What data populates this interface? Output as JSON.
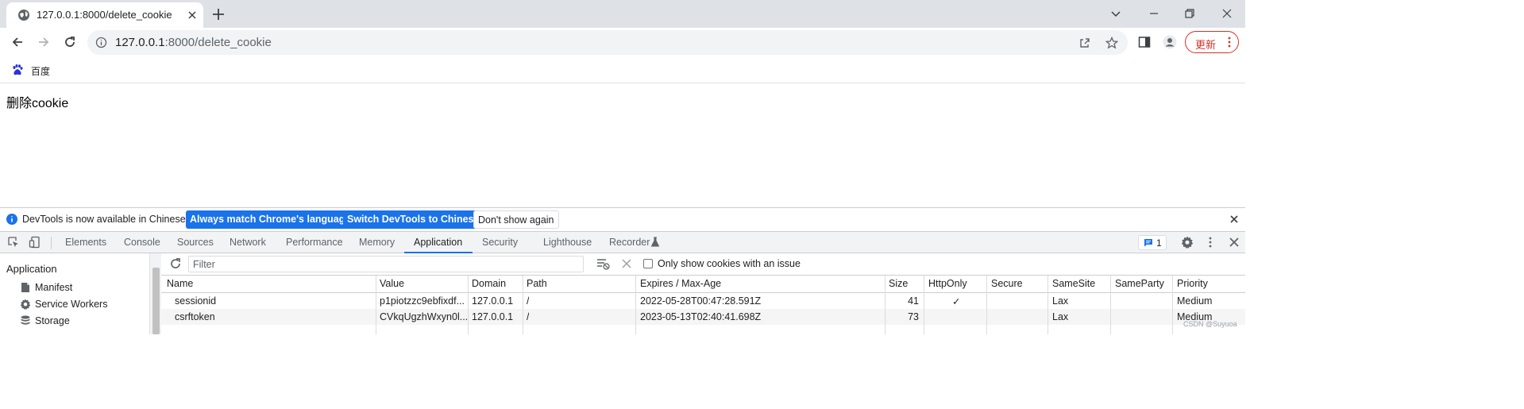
{
  "browser": {
    "tab_title": "127.0.0.1:8000/delete_cookie",
    "url_host": "127.0.0.1",
    "url_rest": ":8000/delete_cookie",
    "update_label": "更新",
    "accent": "#1a73e8",
    "update_color": "#d93025"
  },
  "bookmarks": [
    {
      "label": "百度",
      "icon": "baidu-paw-icon"
    }
  ],
  "page": {
    "text": "删除cookie"
  },
  "devtools": {
    "infobar": {
      "message": "DevTools is now available in Chinese!",
      "btn_match": "Always match Chrome's language",
      "btn_switch": "Switch DevTools to Chinese",
      "btn_dismiss": "Don't show again"
    },
    "tabs": [
      "Elements",
      "Console",
      "Sources",
      "Network",
      "Performance",
      "Memory",
      "Application",
      "Security",
      "Lighthouse",
      "Recorder"
    ],
    "active_tab": "Application",
    "issues_count": "1",
    "sidebar": {
      "heading": "Application",
      "items": [
        {
          "label": "Manifest",
          "icon": "file-icon"
        },
        {
          "label": "Service Workers",
          "icon": "gear-icon"
        },
        {
          "label": "Storage",
          "icon": "database-icon"
        }
      ]
    },
    "cookies": {
      "filter_placeholder": "Filter",
      "only_issue_label": "Only show cookies with an issue",
      "columns": [
        "Name",
        "Value",
        "Domain",
        "Path",
        "Expires / Max-Age",
        "Size",
        "HttpOnly",
        "Secure",
        "SameSite",
        "SameParty",
        "Priority"
      ],
      "rows": [
        {
          "name": "sessionid",
          "value": "p1piotzzc9ebfixdf...",
          "domain": "127.0.0.1",
          "path": "/",
          "expires": "2022-05-28T00:47:28.591Z",
          "size": "41",
          "httponly": "✓",
          "secure": "",
          "samesite": "Lax",
          "sameparty": "",
          "priority": "Medium"
        },
        {
          "name": "csrftoken",
          "value": "CVkqUgzhWxyn0l...",
          "domain": "127.0.0.1",
          "path": "/",
          "expires": "2023-05-13T02:40:41.698Z",
          "size": "73",
          "httponly": "",
          "secure": "",
          "samesite": "Lax",
          "sameparty": "",
          "priority": "Medium"
        }
      ]
    }
  },
  "watermark": "CSDN @Suyuoa"
}
